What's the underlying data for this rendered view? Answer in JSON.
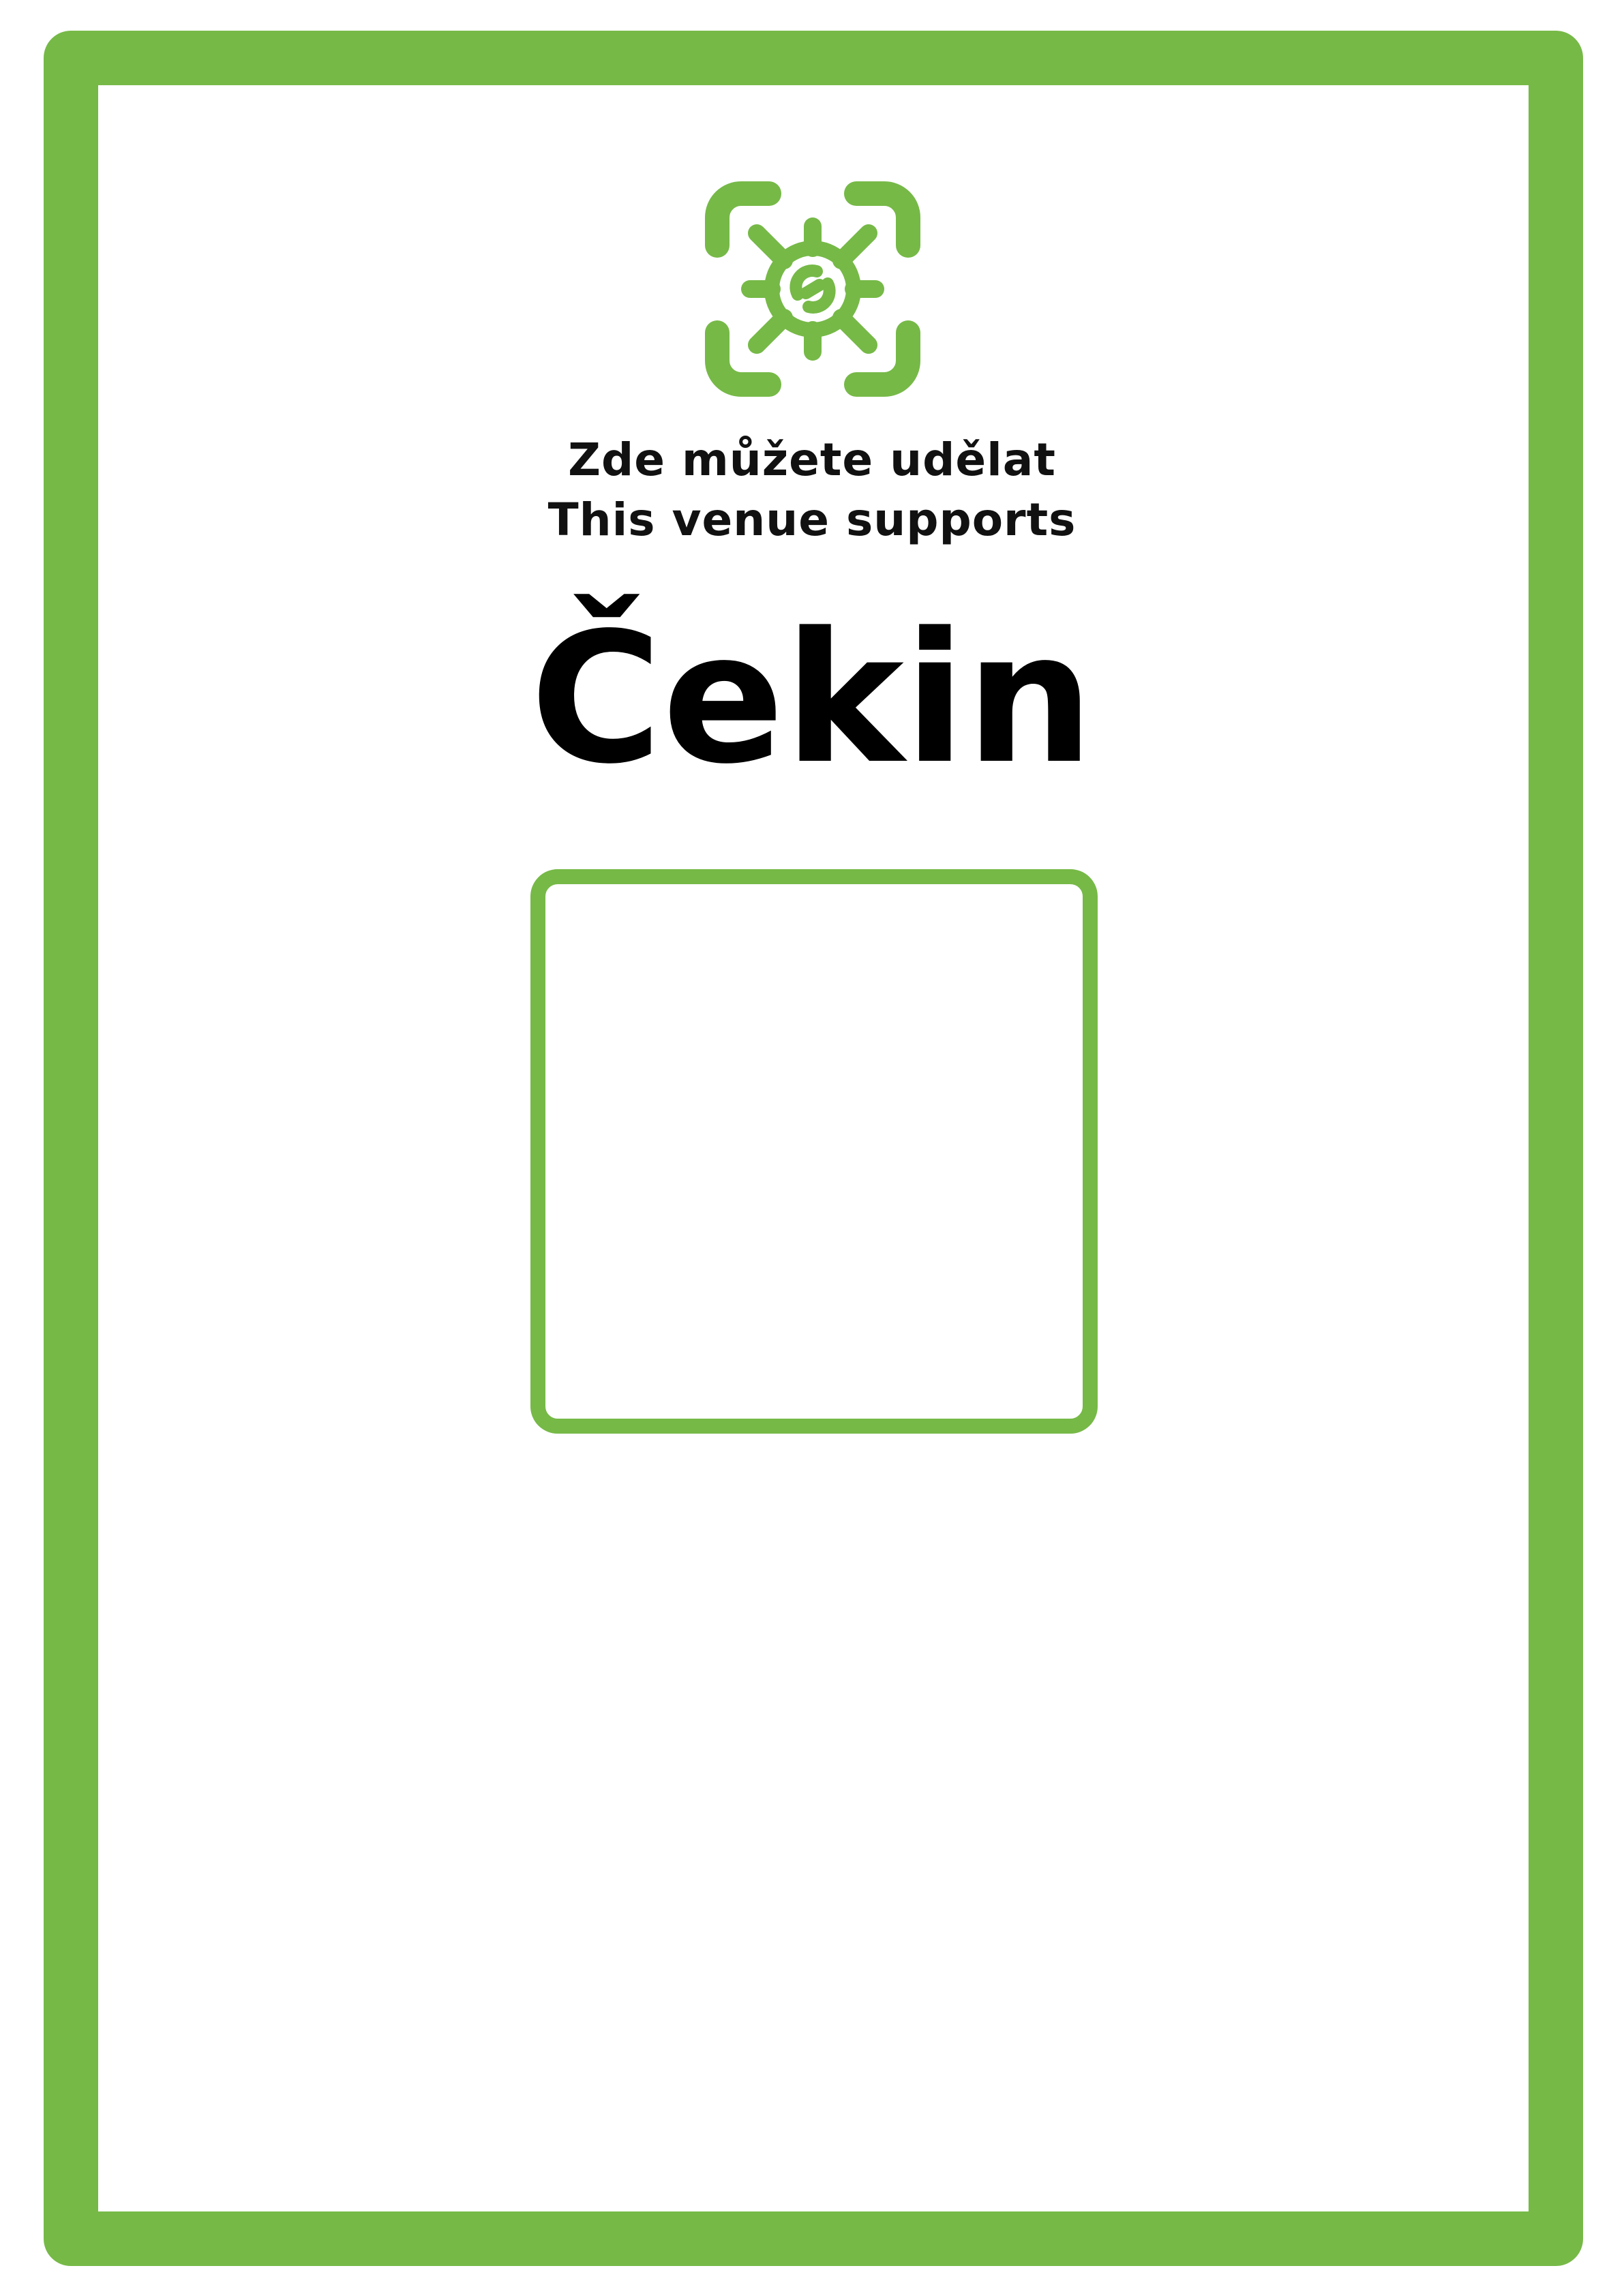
{
  "poster": {
    "logo_icon": "virus-scan-icon",
    "accent_color": "#76b947",
    "subtitle_cs": "Zde můžete udělat",
    "subtitle_en": "This venue supports",
    "brand_name": "Čekin"
  },
  "qr_placeholder": {
    "empty": true
  }
}
